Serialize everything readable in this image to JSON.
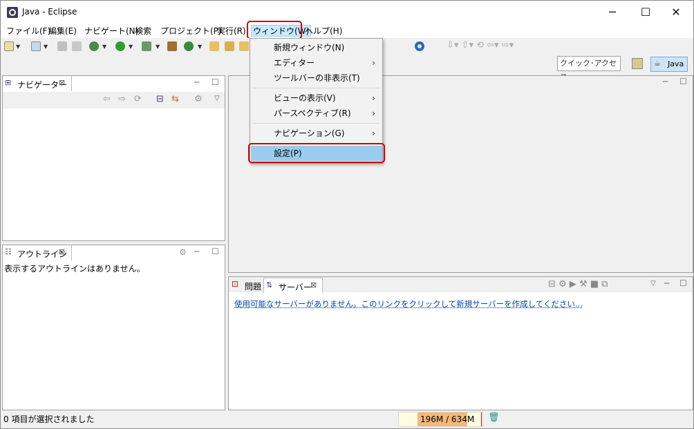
{
  "window": {
    "title": "Java - Eclipse"
  },
  "menubar": {
    "items": [
      {
        "label": "ファイル(F)"
      },
      {
        "label": "編集(E)"
      },
      {
        "label": "ナビゲート(N)"
      },
      {
        "label": "検索"
      },
      {
        "label": "プロジェクト(P)"
      },
      {
        "label": "実行(R)"
      },
      {
        "label": "ウィンドウ(W)"
      },
      {
        "label": "ヘルプ(H)"
      }
    ]
  },
  "window_menu": {
    "items": [
      {
        "label": "新規ウィンドウ(N)",
        "submenu": false
      },
      {
        "label": "エディター",
        "submenu": true
      },
      {
        "label": "ツールバーの非表示(T)",
        "submenu": false
      },
      {
        "label": "ビューの表示(V)",
        "submenu": true
      },
      {
        "label": "パースペクティブ(R)",
        "submenu": true
      },
      {
        "label": "ナビゲーション(G)",
        "submenu": true
      },
      {
        "label": "設定(P)",
        "submenu": false
      }
    ],
    "arrow": "›"
  },
  "toolbar": {
    "quick_access_placeholder": "クイック･アクセス",
    "perspective_label": "Java"
  },
  "navigator": {
    "tab_label": "ナビゲーター"
  },
  "outline": {
    "tab_label": "アウトライン",
    "empty_message": "表示するアウトラインはありません。"
  },
  "bottom_panel": {
    "tabs": [
      {
        "label": "問題"
      },
      {
        "label": "サーバー"
      }
    ],
    "server_link": "使用可能なサーバーがありません。このリンクをクリックして新規サーバーを作成してください..."
  },
  "status": {
    "selection_text": "0 項目が選択されました",
    "heap": "196M / 634M",
    "heap_used_fraction": 0.31
  },
  "colors": {
    "highlight_red": "#d00000",
    "menu_selected": "#cce8ff",
    "item_hover": "#99ccee",
    "heap_fill": "#f6b87a"
  }
}
